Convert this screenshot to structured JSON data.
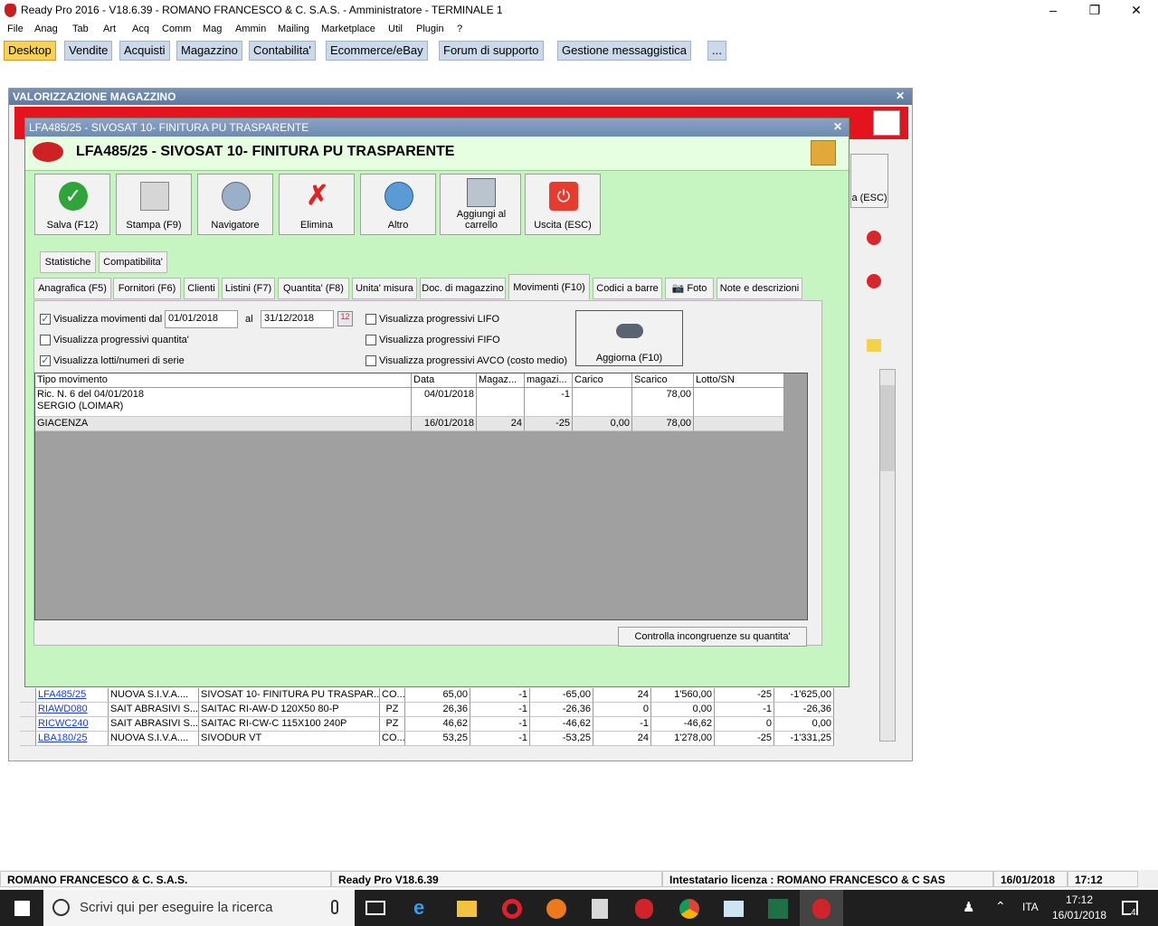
{
  "window": {
    "title": "Ready Pro 2016 - V18.6.39 - ROMANO FRANCESCO & C. S.A.S. - Amministratore - TERMINALE 1"
  },
  "menu": [
    "File",
    "Anag",
    "Tab",
    "Art",
    "Acq",
    "Comm",
    "Mag",
    "Ammin",
    "Mailing",
    "Marketplace",
    "Util",
    "Plugin",
    "?"
  ],
  "tabs": [
    "Desktop",
    "Vendite",
    "Acquisti",
    "Magazzino",
    "Contabilita'",
    "Ecommerce/eBay",
    "Forum di supporto",
    "Gestione messaggistica",
    "..."
  ],
  "bg_window": {
    "title": "VALORIZZAZIONE MAGAZZINO",
    "esc_label": "a (ESC)"
  },
  "dialog": {
    "title": "LFA485/25 - SIVOSAT 10- FINITURA PU TRASPARENTE",
    "header": "LFA485/25 - SIVOSAT 10- FINITURA PU TRASPARENTE",
    "buttons": [
      "Salva (F12)",
      "Stampa (F9)",
      "Navigatore",
      "Elimina",
      "Altro",
      "Aggiungi al carrello",
      "Uscita (ESC)"
    ],
    "tabs_top": [
      "Statistiche",
      "Compatibilita'"
    ],
    "tabs_bottom": [
      "Anagrafica (F5)",
      "Fornitori (F6)",
      "Clienti",
      "Listini (F7)",
      "Quantita' (F8)",
      "Unita' misura",
      "Doc. di magazzino",
      "Movimenti (F10)",
      "Codici a barre",
      "Foto",
      "Note e descrizioni"
    ],
    "filters": {
      "mov_label": "Visualizza movimenti dal",
      "from": "01/01/2018",
      "al_label": "al",
      "to": "31/12/2018",
      "prog_qty_label": "Visualizza progressivi quantita'",
      "lotti_label": "Visualizza lotti/numeri di serie",
      "lifo_label": "Visualizza progressivi LIFO",
      "fifo_label": "Visualizza progressivi FIFO",
      "avco_label": "Visualizza progressivi AVCO (costo medio)",
      "aggiorna": "Aggiorna (F10)"
    },
    "grid": {
      "headers": [
        "Tipo movimento",
        "Data",
        "Magaz...",
        "magazi...",
        "Carico",
        "Scarico",
        "Lotto/SN"
      ],
      "rows": [
        {
          "tipo1": "Ric. N. 6 del 04/01/2018",
          "tipo2": "SERGIO (LOIMAR)",
          "data": "04/01/2018",
          "magaz": "",
          "magazi": "-1",
          "carico": "",
          "scarico": "78,00",
          "lotto": ""
        },
        {
          "tipo1": "GIACENZA",
          "tipo2": "",
          "data": "16/01/2018",
          "magaz": "24",
          "magazi": "-25",
          "carico": "0,00",
          "scarico": "78,00",
          "lotto": ""
        }
      ]
    },
    "check_button": "Controlla incongruenze su quantita'"
  },
  "bg_rows": [
    [
      "LFA485/25",
      "NUOVA S.I.V.A....",
      "SIVOSAT 10- FINITURA PU TRASPAR...",
      "CO...",
      "65,00",
      "-1",
      "-65,00",
      "24",
      "1'560,00",
      "-25",
      "-1'625,00"
    ],
    [
      "RIAWD080",
      "SAIT ABRASIVI S...",
      "SAITAC RI-AW-D 120X50 80-P",
      "PZ",
      "26,36",
      "-1",
      "-26,36",
      "0",
      "0,00",
      "-1",
      "-26,36"
    ],
    [
      "RICWC240",
      "SAIT ABRASIVI S...",
      "SAITAC RI-CW-C 115X100 240P",
      "PZ",
      "46,62",
      "-1",
      "-46,62",
      "-1",
      "-46,62",
      "0",
      "0,00"
    ],
    [
      "LBA180/25",
      "NUOVA S.I.V.A....",
      "SIVODUR VT",
      "CO...",
      "53,25",
      "-1",
      "-53,25",
      "24",
      "1'278,00",
      "-25",
      "-1'331,25"
    ]
  ],
  "status": [
    "ROMANO FRANCESCO & C. S.A.S.",
    "Ready Pro V18.6.39",
    "Intestatario licenza : ROMANO FRANCESCO & C SAS",
    "16/01/2018",
    "17:12"
  ],
  "taskbar": {
    "search": "Scrivi qui per eseguire la ricerca",
    "lang": "ITA",
    "time": "17:12",
    "date": "16/01/2018",
    "notif": "4"
  }
}
